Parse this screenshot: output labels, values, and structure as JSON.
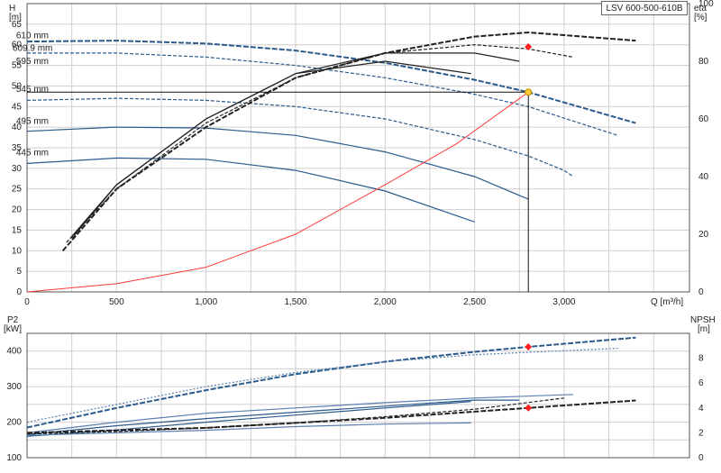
{
  "model_label": "LSV 600-500-610B",
  "colors": {
    "curve": "#2b5a8c",
    "curve_light": "#5a7fb0",
    "eff": "#222222",
    "system": "#ff3b3b",
    "point_red": "#ff2020",
    "point_yellow": "#ffcc33",
    "grid": "#cfcfcf"
  },
  "chart_data": [
    {
      "type": "line",
      "ylabel_unit_left": [
        "H",
        "[m]"
      ],
      "ylabel_unit_right": [
        "eta",
        "[%]"
      ],
      "xlabel": "Q [m³/h]",
      "xlim": [
        0,
        3700
      ],
      "ylim": [
        0,
        70
      ],
      "y2lim": [
        0,
        100
      ],
      "x_ticks": [
        "0",
        "500",
        "1,000",
        "1,500",
        "2,000",
        "2,500",
        "3,000"
      ],
      "x_tick_values": [
        0,
        500,
        1000,
        1500,
        2000,
        2500,
        3000
      ],
      "y_ticks": [
        0,
        5,
        10,
        15,
        20,
        25,
        30,
        35,
        40,
        45,
        50,
        55,
        60,
        65
      ],
      "y2_ticks": [
        0,
        20,
        40,
        60,
        80,
        100
      ],
      "duty_point": {
        "x": 2800,
        "head": 48.5,
        "eta": 85
      },
      "diameter_labels": [
        {
          "text": "610 mm",
          "x": 90,
          "y": 62.2
        },
        {
          "text": "609.9 mm",
          "x": 70,
          "y": 59.2
        },
        {
          "text": "595 mm",
          "x": 90,
          "y": 56.0
        },
        {
          "text": "545 mm",
          "x": 90,
          "y": 49.2
        },
        {
          "text": "495 mm",
          "x": 90,
          "y": 41.5
        },
        {
          "text": "445 mm",
          "x": 90,
          "y": 33.8
        }
      ],
      "head_curves": [
        {
          "points": [
            [
              0,
              60.8
            ],
            [
              500,
              61
            ],
            [
              1000,
              60.3
            ],
            [
              1500,
              58.6
            ],
            [
              2000,
              55.6
            ],
            [
              2500,
              51.5
            ],
            [
              2800,
              48.5
            ],
            [
              3400,
              41
            ]
          ],
          "style": "dash-bold"
        },
        {
          "points": [
            [
              0,
              58
            ],
            [
              500,
              58
            ],
            [
              1000,
              57
            ],
            [
              1500,
              55
            ],
            [
              2000,
              52
            ],
            [
              2500,
              48
            ],
            [
              2800,
              45
            ],
            [
              3300,
              38
            ]
          ],
          "style": "dash"
        },
        {
          "points": [
            [
              0,
              46.5
            ],
            [
              500,
              47
            ],
            [
              1000,
              46.5
            ],
            [
              1500,
              45
            ],
            [
              2000,
              42
            ],
            [
              2500,
              37
            ],
            [
              2800,
              33
            ],
            [
              3000,
              29.5
            ],
            [
              3050,
              28
            ]
          ],
          "style": "dash-split"
        },
        {
          "points": [
            [
              0,
              39
            ],
            [
              500,
              40
            ],
            [
              1000,
              39.8
            ],
            [
              1500,
              38
            ],
            [
              2000,
              34
            ],
            [
              2500,
              28
            ],
            [
              2800,
              22.5
            ]
          ],
          "style": "solid-split"
        },
        {
          "points": [
            [
              0,
              31.2
            ],
            [
              500,
              32.5
            ],
            [
              1000,
              32.2
            ],
            [
              1500,
              29.5
            ],
            [
              2000,
              24.5
            ],
            [
              2500,
              17
            ]
          ],
          "style": "solid"
        }
      ],
      "efficiency_curves": [
        {
          "points": [
            [
              200,
              10
            ],
            [
              500,
              25
            ],
            [
              1000,
              40
            ],
            [
              1500,
              52
            ],
            [
              2000,
              58
            ],
            [
              2500,
              62
            ],
            [
              2800,
              63
            ],
            [
              3400,
              61
            ]
          ],
          "style": "dash-bold"
        },
        {
          "points": [
            [
              220,
              12
            ],
            [
              500,
              25
            ],
            [
              1000,
              41
            ],
            [
              1500,
              52
            ],
            [
              2000,
              58
            ],
            [
              2500,
              60
            ],
            [
              2800,
              59
            ],
            [
              3050,
              57
            ]
          ],
          "style": "dash"
        },
        {
          "points": [
            [
              240,
              13
            ],
            [
              500,
              26
            ],
            [
              1000,
              42
            ],
            [
              1500,
              53
            ],
            [
              2000,
              58
            ],
            [
              2500,
              58
            ],
            [
              2750,
              56
            ]
          ],
          "style": "solid"
        },
        {
          "points": [
            [
              250,
              13
            ],
            [
              500,
              26
            ],
            [
              1000,
              42
            ],
            [
              1500,
              53
            ],
            [
              2000,
              56
            ],
            [
              2480,
              53
            ]
          ],
          "style": "solid"
        }
      ],
      "system_curve": {
        "points": [
          [
            0,
            0
          ],
          [
            500,
            2
          ],
          [
            1000,
            6
          ],
          [
            1500,
            14
          ],
          [
            2000,
            26
          ],
          [
            2400,
            36
          ],
          [
            2800,
            48.5
          ]
        ]
      }
    },
    {
      "type": "line",
      "ylabel_unit_left": [
        "P2",
        "[kW]"
      ],
      "ylabel_unit_right": [
        "NPSH",
        "[m]"
      ],
      "xlim": [
        0,
        3700
      ],
      "ylim": [
        100,
        450
      ],
      "y2lim": [
        0,
        10
      ],
      "y_ticks": [
        100,
        200,
        300,
        400
      ],
      "y2_ticks": [
        0,
        2,
        4,
        6,
        8
      ],
      "duty_point": {
        "x": 2800,
        "power": 412,
        "npsh": 4.0
      },
      "power_curves": [
        {
          "points": [
            [
              0,
              185
            ],
            [
              500,
              240
            ],
            [
              1000,
              290
            ],
            [
              1500,
              335
            ],
            [
              2000,
              370
            ],
            [
              2500,
              398
            ],
            [
              2800,
              412
            ],
            [
              3400,
              438
            ]
          ],
          "style": "dash-bold"
        },
        {
          "points": [
            [
              0,
              200
            ],
            [
              500,
              250
            ],
            [
              1000,
              300
            ],
            [
              1500,
              340
            ],
            [
              2000,
              370
            ],
            [
              2500,
              390
            ],
            [
              3300,
              408
            ]
          ],
          "style": "dash-light"
        },
        {
          "points": [
            [
              0,
              170
            ],
            [
              500,
              200
            ],
            [
              1000,
              225
            ],
            [
              1500,
              240
            ],
            [
              2000,
              255
            ],
            [
              2500,
              268
            ],
            [
              3050,
              278
            ]
          ],
          "style": "solid-light"
        },
        {
          "points": [
            [
              0,
              165
            ],
            [
              500,
              190
            ],
            [
              1000,
              210
            ],
            [
              1500,
              228
            ],
            [
              2000,
              245
            ],
            [
              2500,
              262
            ],
            [
              2750,
              262
            ]
          ],
          "style": "solid"
        },
        {
          "points": [
            [
              0,
              160
            ],
            [
              500,
              178
            ],
            [
              1000,
              200
            ],
            [
              1500,
              220
            ],
            [
              2000,
              240
            ],
            [
              2480,
              258
            ]
          ],
          "style": "solid"
        }
      ],
      "npsh_curves": [
        {
          "points": [
            [
              0,
              2.0
            ],
            [
              500,
              2.2
            ],
            [
              1000,
              2.4
            ],
            [
              1500,
              2.8
            ],
            [
              2000,
              3.2
            ],
            [
              2500,
              3.7
            ],
            [
              2800,
              4.0
            ],
            [
              3400,
              4.6
            ]
          ],
          "style": "dash-bold"
        },
        {
          "points": [
            [
              0,
              1.9
            ],
            [
              500,
              2.1
            ],
            [
              1000,
              2.4
            ],
            [
              1500,
              2.8
            ],
            [
              2000,
              3.3
            ],
            [
              2500,
              3.9
            ],
            [
              3000,
              4.8
            ]
          ],
          "style": "dash"
        },
        {
          "points": [
            [
              0,
              1.8
            ],
            [
              500,
              2.0
            ],
            [
              1000,
              2.2
            ],
            [
              1500,
              2.5
            ],
            [
              2000,
              2.7
            ],
            [
              2480,
              2.8
            ]
          ],
          "style": "solid-light"
        }
      ]
    }
  ]
}
